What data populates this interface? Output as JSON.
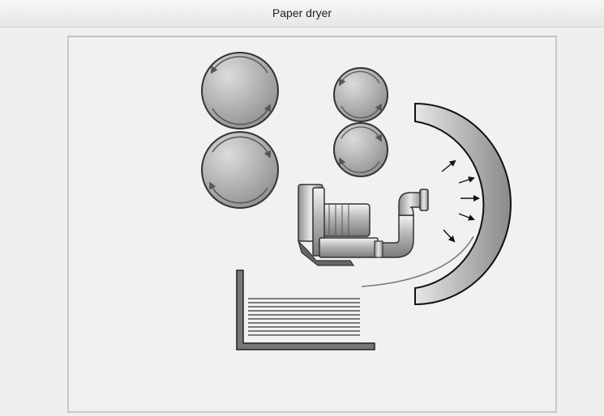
{
  "window": {
    "title": "Paper dryer"
  },
  "colors": {
    "background": "#efefef",
    "panel": "#f1f1f1",
    "stroke": "#333333",
    "roller_light": "#d9d9d9",
    "roller_dark": "#8a8a8a",
    "paper_line": "#666666"
  },
  "icons": {
    "roller_rotation": "circular-arrow",
    "air_flow": "arrow"
  }
}
